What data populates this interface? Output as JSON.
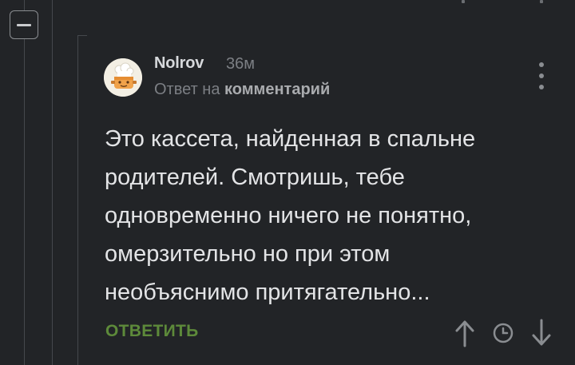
{
  "thread": {
    "collapse_icon": "minus-icon"
  },
  "comment": {
    "author": "Nolrov",
    "time": "36м",
    "reply_prefix": "Ответ на",
    "reply_link": "комментарий",
    "text_lines": [
      "Это кассета, найденная в спальне",
      "родителей. Смотришь, тебе",
      "одновременно ничего не понятно,",
      "омерзительно но при этом",
      "необъяснимо притягательно..."
    ],
    "avatar_icon": "chef-hat-avatar-icon",
    "more_icon": "more-vertical-icon"
  },
  "actions": {
    "reply_label": "ОТВЕТИТЬ",
    "upvote_icon": "arrow-up-icon",
    "save_icon": "clock-icon",
    "downvote_icon": "arrow-down-icon"
  },
  "colors": {
    "background": "#222427",
    "text": "#e3e4e6",
    "muted": "#7c7f84",
    "accent_green": "#5d8a3a"
  }
}
